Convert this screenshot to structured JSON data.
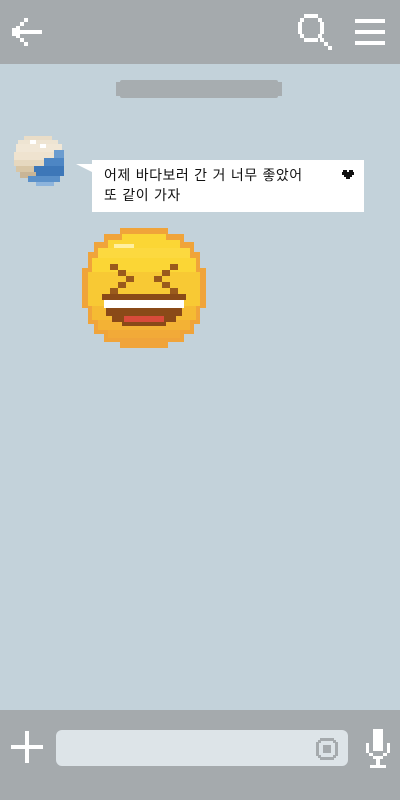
{
  "header": {
    "back_icon": "arrow-left-icon",
    "search_icon": "search-icon",
    "menu_icon": "hamburger-menu-icon"
  },
  "messages": [
    {
      "sender_avatar_icon": "avatar-icon",
      "text": "어제 바다보러 간 거 너무 좋았어\n또 같이 가자",
      "trailing_icon": "heart-icon"
    },
    {
      "sticker_icon": "laughing-emoji-icon"
    }
  ],
  "input_bar": {
    "plus_icon": "plus-icon",
    "input_value": "",
    "sticker_icon": "sticker-icon",
    "mic_icon": "microphone-icon"
  },
  "colors": {
    "header_bg": "#a5aaad",
    "chat_bg": "#c3d2da",
    "bubble_bg": "#ffffff",
    "input_bg": "#dde4e8"
  }
}
